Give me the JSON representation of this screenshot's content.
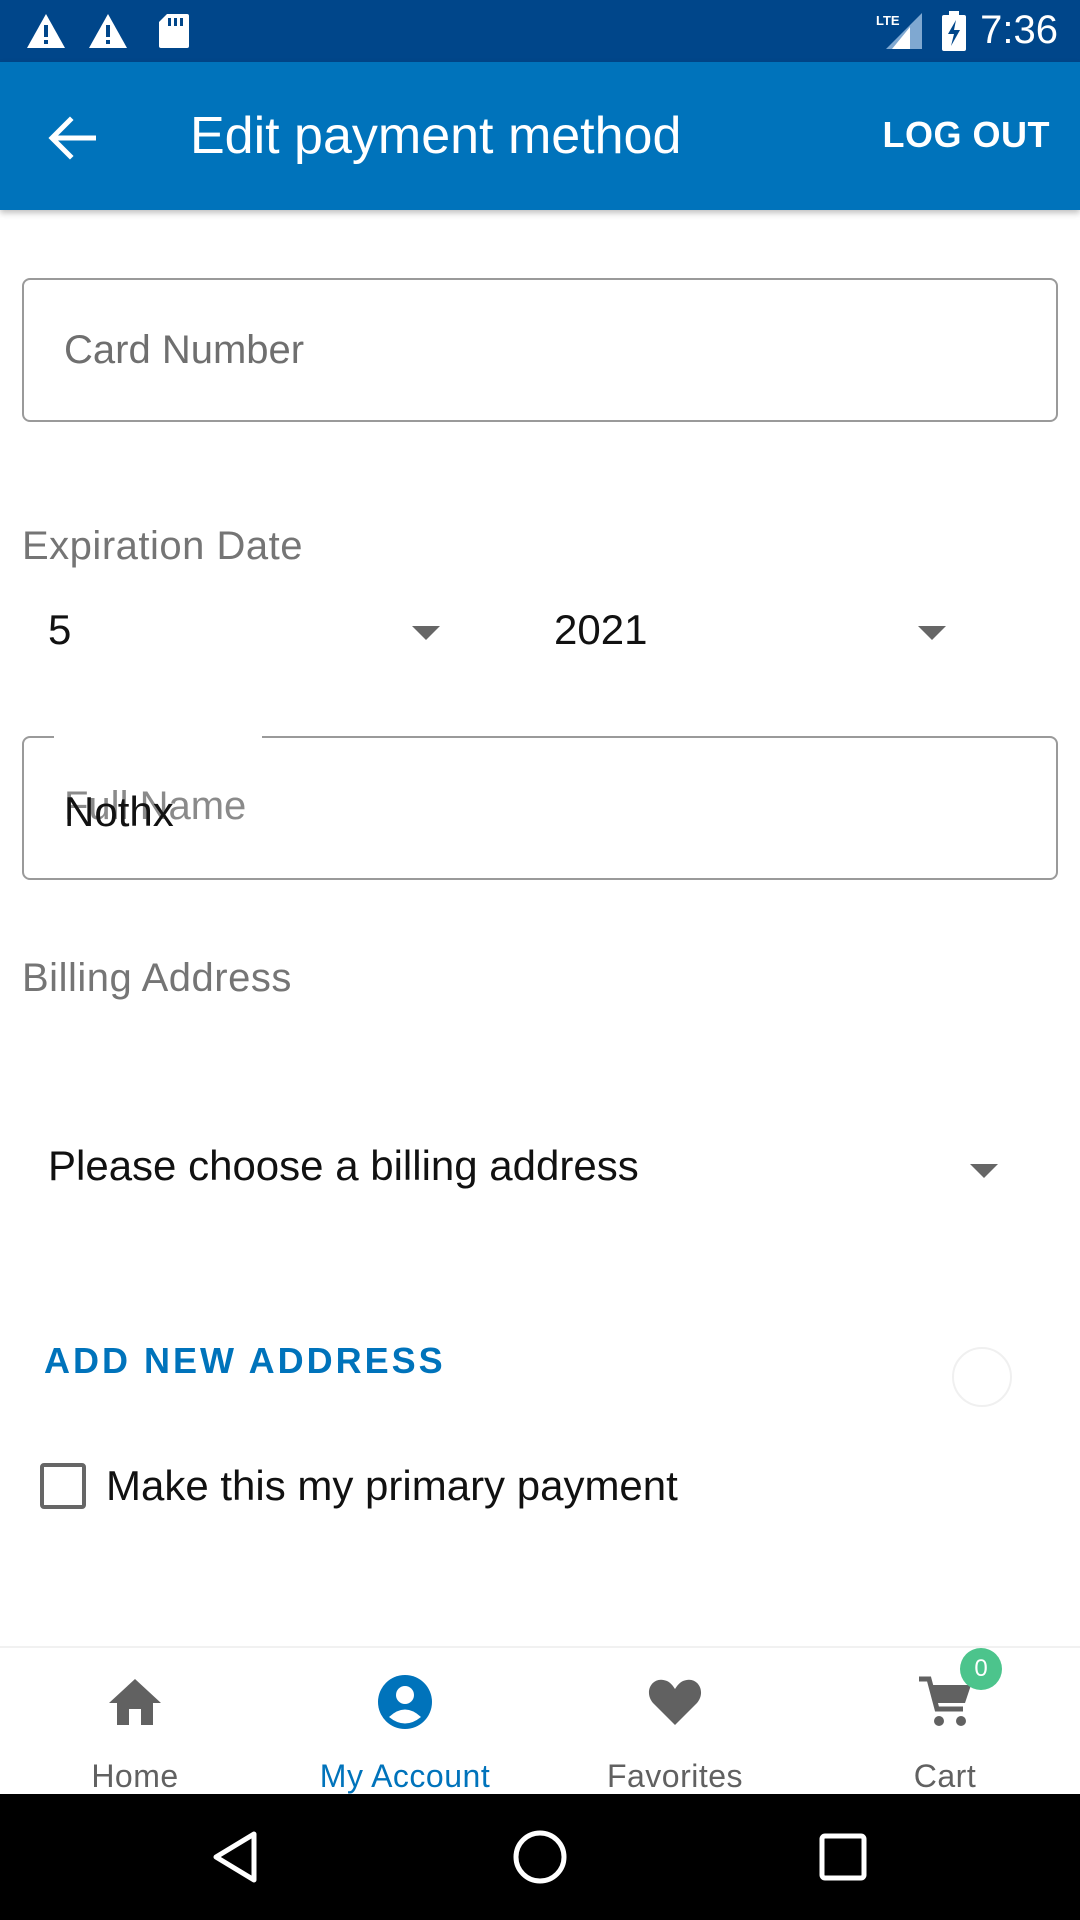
{
  "status_bar": {
    "time": "7:36",
    "left_icons": [
      "warning-icon",
      "warning-icon",
      "sd-card-icon"
    ],
    "right_icons": [
      "lte-signal-icon",
      "battery-charging-icon"
    ],
    "lte_label": "LTE"
  },
  "app_bar": {
    "title": "Edit payment method",
    "logout_label": "LOG OUT",
    "back_icon": "arrow-back-icon"
  },
  "form": {
    "card_number_placeholder": "Card Number",
    "expiration_label": "Expiration Date",
    "expiration_month": "5",
    "expiration_year": "2021",
    "full_name_label": "Full Name",
    "full_name_value": "Nothx",
    "billing_label": "Billing Address",
    "billing_select_value": "Please choose a billing address",
    "add_address_label": "ADD NEW ADDRESS",
    "primary_checkbox_label": "Make this my primary payment",
    "primary_checked": false
  },
  "bottom_nav": {
    "items": [
      {
        "label": "Home",
        "icon": "home-icon"
      },
      {
        "label": "My Account",
        "icon": "account-icon"
      },
      {
        "label": "Favorites",
        "icon": "heart-icon"
      },
      {
        "label": "Cart",
        "icon": "cart-icon"
      }
    ],
    "active_index": 1,
    "cart_badge": "0"
  },
  "colors": {
    "status_bar": "#00468a",
    "app_bar": "#0073bb",
    "accent": "#0073bb",
    "badge": "#4cc48c"
  }
}
